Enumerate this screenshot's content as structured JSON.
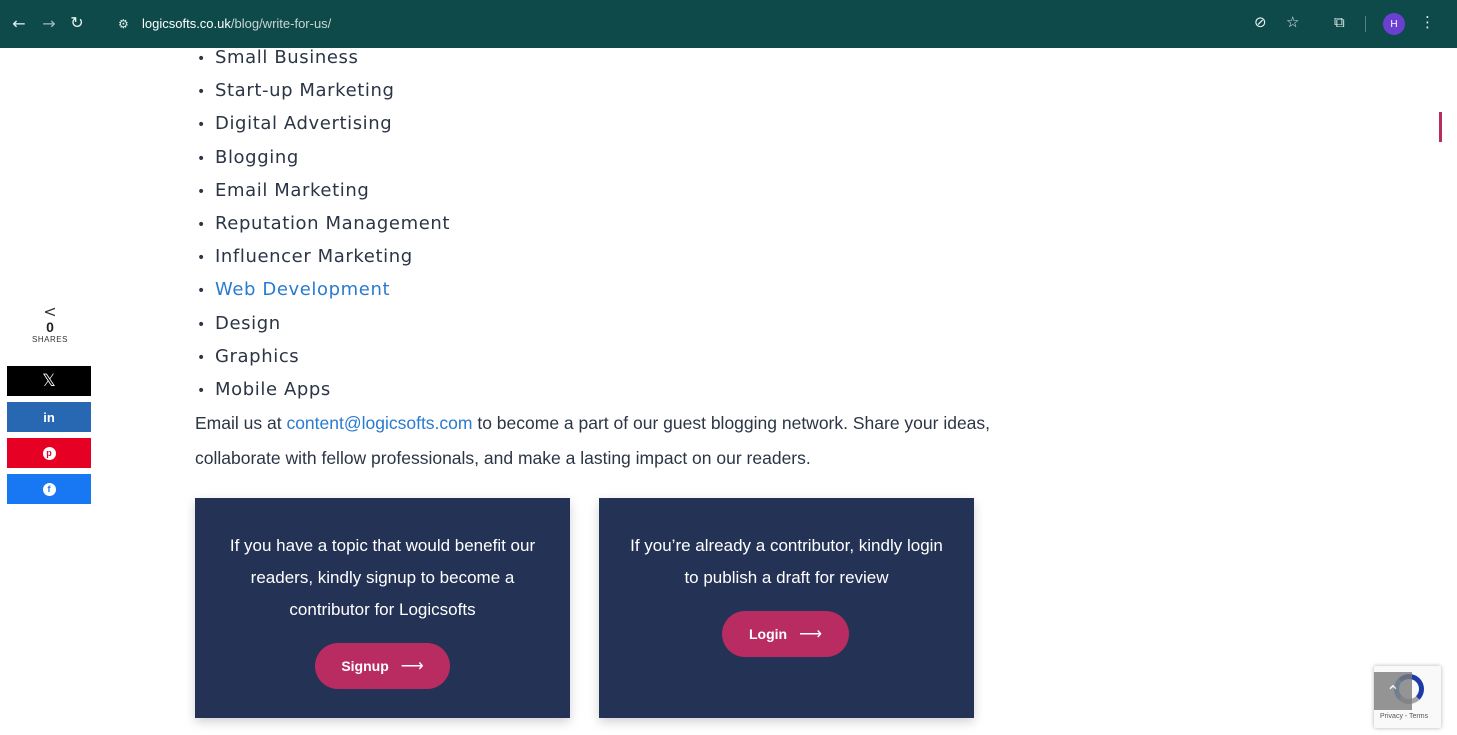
{
  "browser": {
    "url_domain": "logicsofts.co.uk",
    "url_path": "/blog/write-for-us/",
    "profile_initial": "H"
  },
  "share": {
    "count": "0",
    "label": "SHARES",
    "buttons": [
      {
        "name": "x",
        "glyph": "𝕏",
        "color": "#000000"
      },
      {
        "name": "linkedin",
        "glyph": "in",
        "color": "#2867b2"
      },
      {
        "name": "pinterest",
        "glyph": "p",
        "color": "#e60023"
      },
      {
        "name": "facebook",
        "glyph": "f",
        "color": "#1877f2"
      }
    ]
  },
  "topics": [
    {
      "label": "Small Business",
      "is_link": false
    },
    {
      "label": "Start-up Marketing",
      "is_link": false
    },
    {
      "label": "Digital Advertising",
      "is_link": false
    },
    {
      "label": "Blogging",
      "is_link": false
    },
    {
      "label": "Email Marketing",
      "is_link": false
    },
    {
      "label": "Reputation Management",
      "is_link": false
    },
    {
      "label": "Influencer Marketing",
      "is_link": false
    },
    {
      "label": "Web Development",
      "is_link": true
    },
    {
      "label": "Design",
      "is_link": false
    },
    {
      "label": "Graphics",
      "is_link": false
    },
    {
      "label": "Mobile Apps",
      "is_link": false
    }
  ],
  "email_para": {
    "prefix": "Email us at ",
    "email": "content@logicsofts.com",
    "suffix": " to become a part of our guest blogging network. Share your ideas, collaborate with fellow professionals, and make a lasting impact on our readers."
  },
  "cards": {
    "signup": {
      "text": "If you have a topic that would benefit our readers, kindly signup to become a contributor for Logicsofts",
      "button": "Signup"
    },
    "login": {
      "text": "If you’re already a contributor, kindly login to publish a draft for review",
      "button": "Login"
    }
  },
  "recaptcha": {
    "label": "Privacy - Terms"
  },
  "colors": {
    "browser_bar": "#0f4a4a",
    "card_bg": "#243355",
    "accent": "#b92c62",
    "link": "#2a7ad0"
  }
}
